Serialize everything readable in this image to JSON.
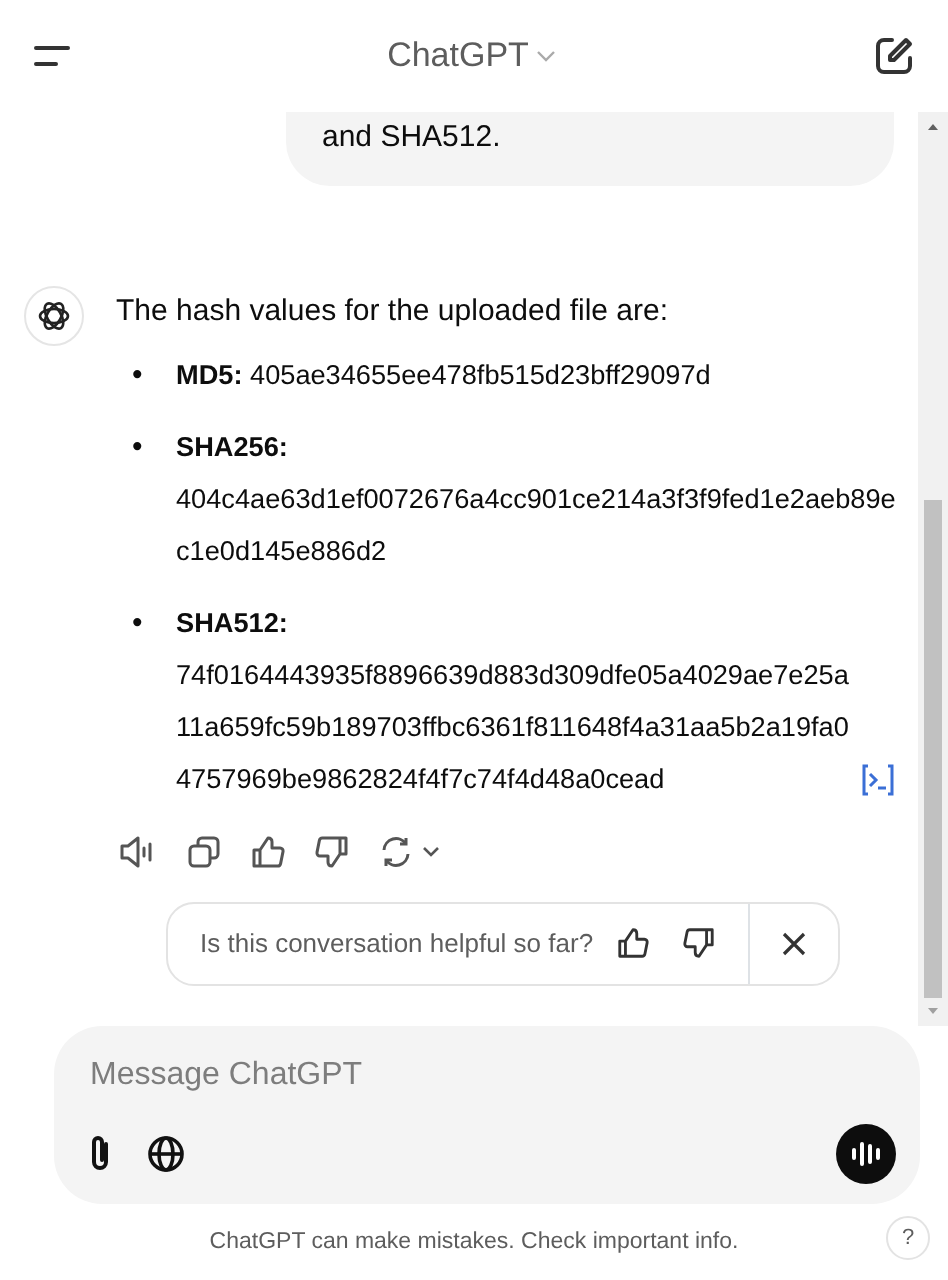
{
  "header": {
    "title": "ChatGPT"
  },
  "user_message": {
    "text": "and SHA512."
  },
  "assistant_message": {
    "intro": "The hash values for the uploaded file are:",
    "items": [
      {
        "marker": "•",
        "text": "**MD5:** 405ae34655ee478fb515d23bff29097d"
      },
      {
        "marker": "•",
        "text": "**SHA256:** 404c4ae63d1ef0072676a4cc901ce214a3f3f9fed1e2aeb89ec1e0d145e886d2"
      },
      {
        "marker": "•",
        "text": "**SHA512:** 74f0164443935f8896639d883d309dfe05a4029ae7e25a11a659fc59b189703ffbc6361f811648f4a31aa5b2a19fa04757969be9862824f4f7c74f4d48a0cead"
      }
    ]
  },
  "feedback": {
    "question": "Is this conversation helpful so far?"
  },
  "composer": {
    "placeholder": "Message ChatGPT"
  },
  "footer": {
    "note": "ChatGPT can make mistakes. Check important info.",
    "help": "?"
  }
}
